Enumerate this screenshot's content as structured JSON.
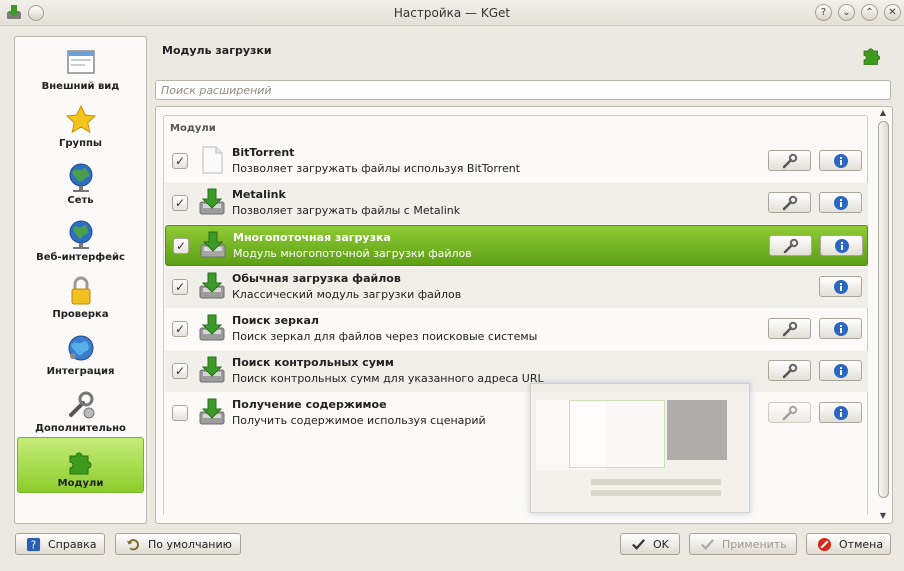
{
  "window": {
    "title": "Настройка — KGet"
  },
  "sidebar": {
    "items": [
      {
        "label": "Внешний вид",
        "icon": "appearance-icon"
      },
      {
        "label": "Группы",
        "icon": "star-icon"
      },
      {
        "label": "Сеть",
        "icon": "network-globe-icon"
      },
      {
        "label": "Веб-интерфейс",
        "icon": "web-globe-icon"
      },
      {
        "label": "Проверка",
        "icon": "lock-icon"
      },
      {
        "label": "Интеграция",
        "icon": "integration-globe-icon"
      },
      {
        "label": "Дополнительно",
        "icon": "tools-icon"
      },
      {
        "label": "Модули",
        "icon": "plugin-icon",
        "active": true
      }
    ]
  },
  "header": {
    "title": "Модуль загрузки"
  },
  "search": {
    "placeholder": "Поиск расширений"
  },
  "modules": {
    "group_title": "Модули",
    "items": [
      {
        "name": "BitTorrent",
        "description": "Позволяет загружать файлы используя BitTorrent",
        "checked": true
      },
      {
        "name": "Metalink",
        "description": "Позволяет загружать файлы с Metalink",
        "checked": true
      },
      {
        "name": "Многопоточная загрузка",
        "description": "Модуль многопоточной загрузки файлов",
        "checked": true,
        "selected": true
      },
      {
        "name": "Обычная загрузка файлов",
        "description": "Классический модуль загрузки файлов",
        "checked": true
      },
      {
        "name": "Поиск зеркал",
        "description": "Поиск зеркал для файлов через поисковые системы",
        "checked": true
      },
      {
        "name": "Поиск контрольных сумм",
        "description": "Поиск контрольных сумм для указанного адреса URL",
        "checked": true
      },
      {
        "name": "Получение содержимое",
        "description": "Получить содержимое используя сценарий",
        "checked": false
      }
    ]
  },
  "buttons": {
    "help": "Справка",
    "defaults": "По умолчанию",
    "ok": "OK",
    "apply": "Применить",
    "cancel": "Отмена"
  },
  "colors": {
    "accent_green": "#6cae1e",
    "selection_dark": "#4f8a12"
  }
}
